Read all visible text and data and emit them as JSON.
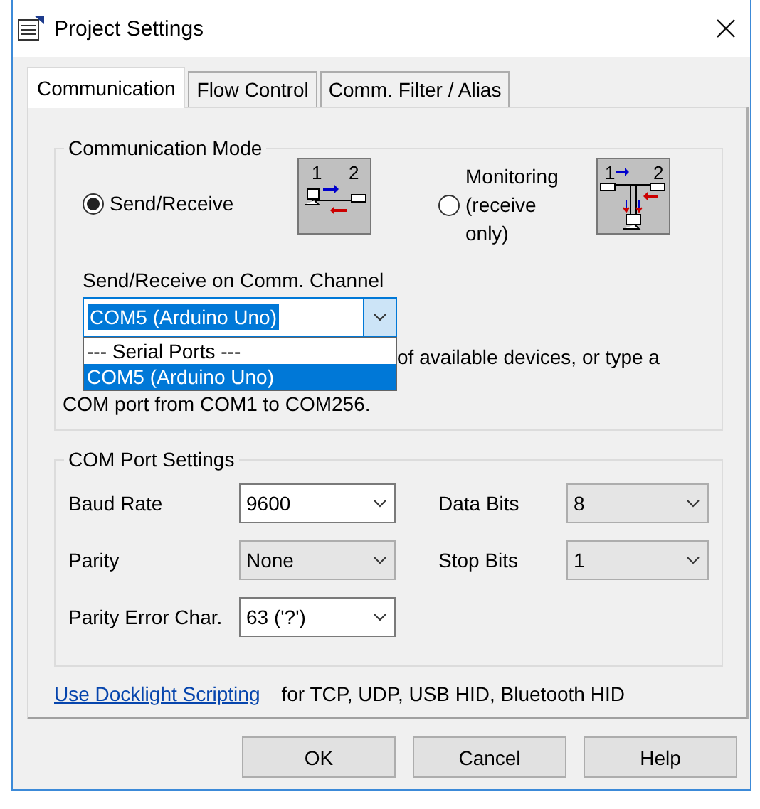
{
  "window": {
    "title": "Project Settings"
  },
  "tabs": [
    {
      "label": "Communication",
      "selected": true
    },
    {
      "label": "Flow Control",
      "selected": false
    },
    {
      "label": "Comm. Filter / Alias",
      "selected": false
    }
  ],
  "communication_mode": {
    "title": "Communication Mode",
    "modes": [
      {
        "label": "Send/Receive",
        "selected": true,
        "kind": "send",
        "diagram_labels": [
          "1",
          "2"
        ]
      },
      {
        "label": "Monitoring (receive only)",
        "selected": false,
        "kind": "monitor",
        "diagram_labels": [
          "1",
          "2"
        ]
      }
    ],
    "channel": {
      "label": "Send/Receive on Comm. Channel",
      "value": "COM5  (Arduino Uno)",
      "focused": true,
      "open": true,
      "options": [
        {
          "text": "--- Serial Ports ---",
          "selected": false
        },
        {
          "text": "COM5  (Arduino Uno)",
          "selected": true
        }
      ]
    },
    "hint_lines": [
      "of available devices, or type a",
      "COM port from COM1 to COM256."
    ]
  },
  "com_port_settings": {
    "title": "COM Port Settings",
    "fields": [
      {
        "label": "Baud Rate",
        "value": "9600",
        "editable": true
      },
      {
        "label": "Data Bits",
        "value": "8",
        "editable": false
      },
      {
        "label": "Parity",
        "value": "None",
        "editable": false
      },
      {
        "label": "Stop Bits",
        "value": "1",
        "editable": false
      },
      {
        "label": "Parity Error Char.",
        "value": "63 ('?')",
        "editable": true
      }
    ]
  },
  "scripting": {
    "link": "Use Docklight Scripting",
    "note": "for TCP, UDP, USB HID, Bluetooth HID"
  },
  "buttons": [
    "OK",
    "Cancel",
    "Help"
  ]
}
